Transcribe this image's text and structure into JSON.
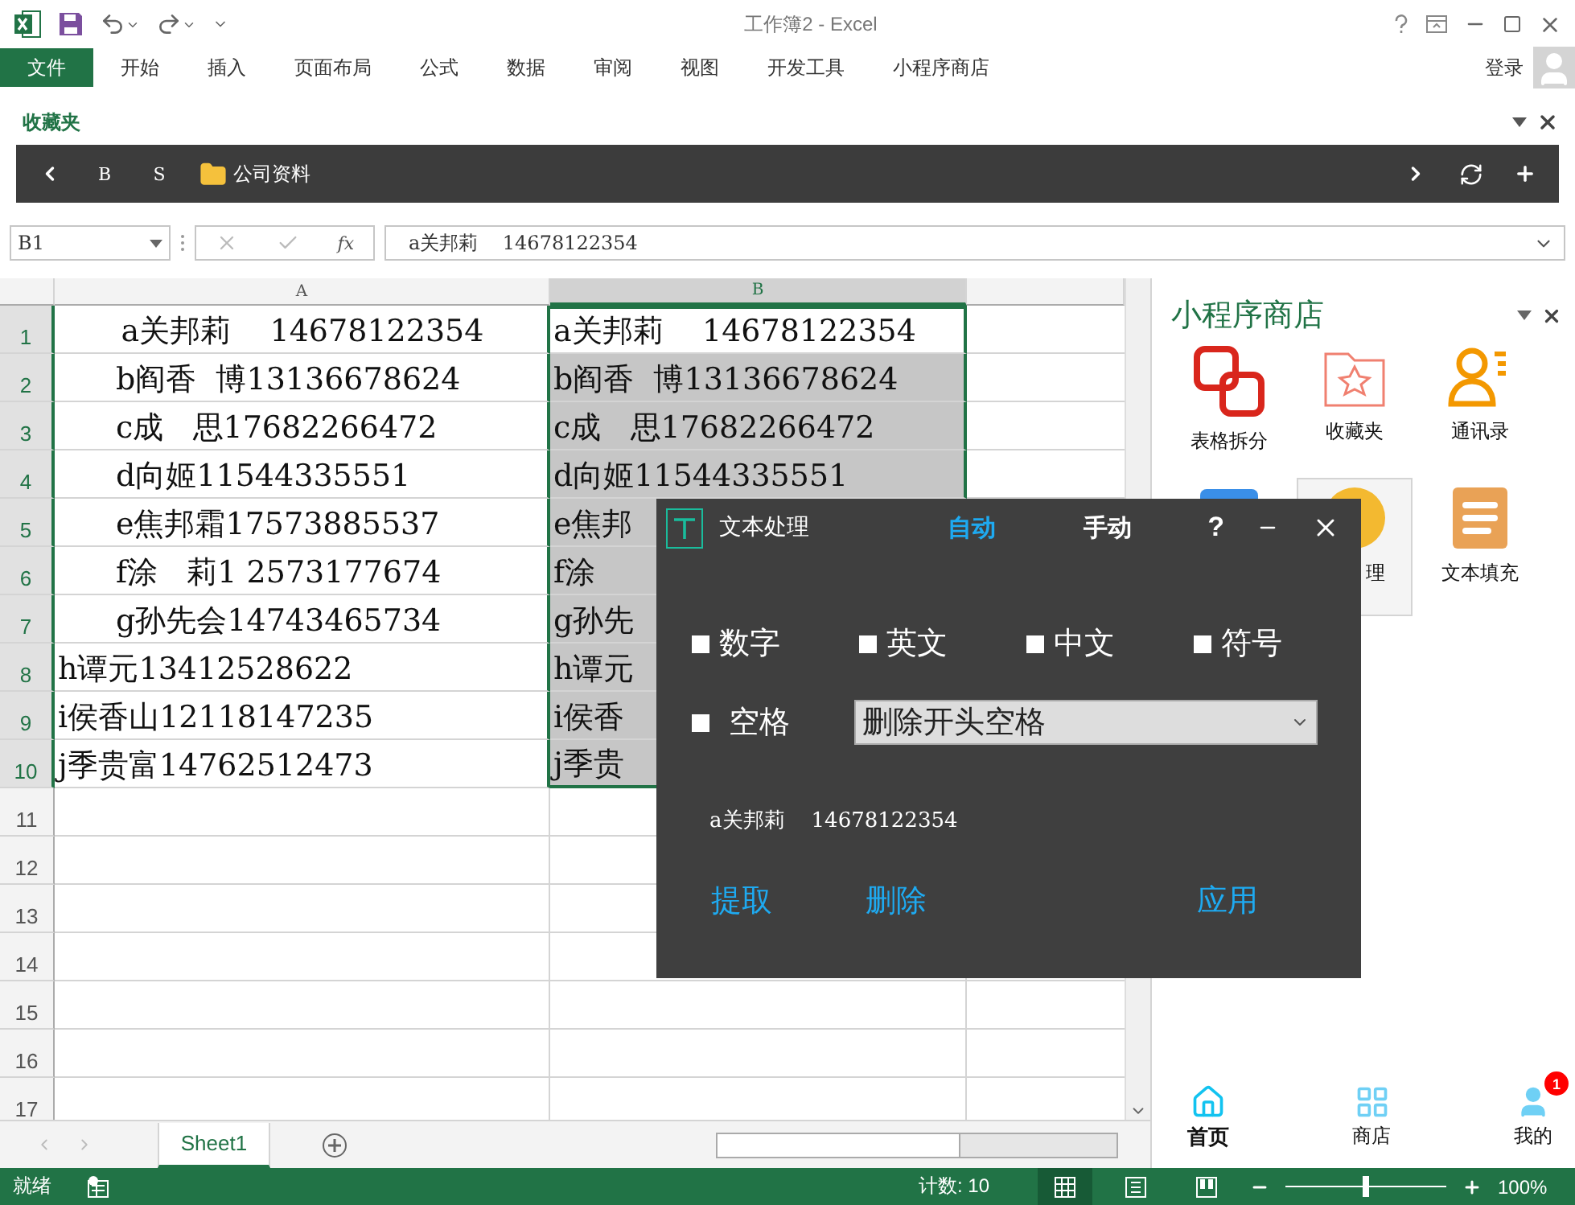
{
  "window": {
    "title": "工作簿2 - Excel"
  },
  "ribbon": {
    "file_tab": "文件",
    "tabs": [
      "开始",
      "插入",
      "页面布局",
      "公式",
      "数据",
      "审阅",
      "视图",
      "开发工具",
      "小程序商店"
    ],
    "sign_in": "登录"
  },
  "favorites": {
    "title": "收藏夹",
    "buttons": [
      "B",
      "S"
    ],
    "folder": "公司资料"
  },
  "formula_bar": {
    "name_box": "B1",
    "fx": "fx",
    "value": "a关邦莉    14678122354"
  },
  "columns": [
    {
      "label": "A",
      "selected": false
    },
    {
      "label": "B",
      "selected": true
    }
  ],
  "rows": [
    {
      "number": "1",
      "a": "a关邦莉    14678122354",
      "a_centered": true,
      "a_indented": false,
      "b": "a关邦莉    14678122354",
      "b_selected": true,
      "b_active": true
    },
    {
      "number": "2",
      "a": "b阎香  博13136678624",
      "a_centered": false,
      "a_indented": true,
      "b": "b阎香  博13136678624",
      "b_selected": true,
      "b_active": false
    },
    {
      "number": "3",
      "a": "c成   思17682266472",
      "a_centered": false,
      "a_indented": true,
      "b": "c成   思17682266472",
      "b_selected": true,
      "b_active": false
    },
    {
      "number": "4",
      "a": "d向姬11544335551",
      "a_centered": false,
      "a_indented": true,
      "b": "d向姬11544335551",
      "b_selected": true,
      "b_active": false
    },
    {
      "number": "5",
      "a": "e焦邦霜17573885537",
      "a_centered": false,
      "a_indented": true,
      "b": "e焦邦",
      "b_selected": true,
      "b_active": false
    },
    {
      "number": "6",
      "a": "f涂   莉1 2573177674",
      "a_centered": false,
      "a_indented": true,
      "b": "f涂",
      "b_selected": true,
      "b_active": false
    },
    {
      "number": "7",
      "a": "g孙先会14743465734",
      "a_centered": false,
      "a_indented": true,
      "b": "g孙先",
      "b_selected": true,
      "b_active": false
    },
    {
      "number": "8",
      "a": "h谭元13412528622",
      "a_centered": false,
      "a_indented": false,
      "b": "h谭元",
      "b_selected": true,
      "b_active": false
    },
    {
      "number": "9",
      "a": "i侯香山12118147235",
      "a_centered": false,
      "a_indented": false,
      "b": "i侯香",
      "b_selected": true,
      "b_active": false
    },
    {
      "number": "10",
      "a": "j季贵富14762512473",
      "a_centered": false,
      "a_indented": false,
      "b": "j季贵",
      "b_selected": true,
      "b_active": false
    },
    {
      "number": "11"
    },
    {
      "number": "12"
    },
    {
      "number": "13"
    },
    {
      "number": "14"
    },
    {
      "number": "15"
    },
    {
      "number": "16"
    },
    {
      "number": "17"
    }
  ],
  "sheet_tabs": [
    {
      "label": "Sheet1",
      "selected": true
    }
  ],
  "status_bar": {
    "status": "就绪",
    "count": "计数: 10",
    "zoom_slider": {
      "level": 0.5
    },
    "zoom": "100%",
    "views": [
      {
        "kind": "normal",
        "selected": true
      },
      {
        "kind": "layout",
        "selected": false
      },
      {
        "kind": "break",
        "selected": false
      }
    ]
  },
  "panel": {
    "title": "小程序商店",
    "items": [
      {
        "kind": "split",
        "label": "表格拆分",
        "selected": false,
        "covered": false
      },
      {
        "kind": "favorites",
        "label": "收藏夹",
        "selected": false,
        "covered": false
      },
      {
        "kind": "contacts",
        "label": "通讯录",
        "selected": false,
        "covered": false
      },
      {
        "kind": "blue",
        "selected": false
      },
      {
        "kind": "yellow",
        "label": "理",
        "selected": true,
        "covered": true
      },
      {
        "kind": "fill",
        "label": "文本填充",
        "selected": false,
        "covered": false
      }
    ],
    "nav": [
      {
        "kind": "home",
        "label": "首页",
        "selected": true
      },
      {
        "kind": "shop",
        "label": "商店",
        "selected": false
      },
      {
        "kind": "me",
        "label": "我的",
        "selected": false,
        "badge": "1"
      }
    ]
  },
  "dialog": {
    "title": "文本处理",
    "tabs": [
      {
        "label": "自动",
        "selected": true
      },
      {
        "label": "手动",
        "selected": false
      }
    ],
    "help": "?",
    "options": [
      {
        "label": "数字",
        "checked": false
      },
      {
        "label": "英文",
        "checked": false
      },
      {
        "label": "中文",
        "checked": false
      },
      {
        "label": "符号",
        "checked": false
      }
    ],
    "space": {
      "label": "空格",
      "checked": false
    },
    "mode": "删除开头空格",
    "preview": "a关邦莉    14678122354",
    "actions": [
      "提取",
      "删除",
      "应用"
    ]
  }
}
